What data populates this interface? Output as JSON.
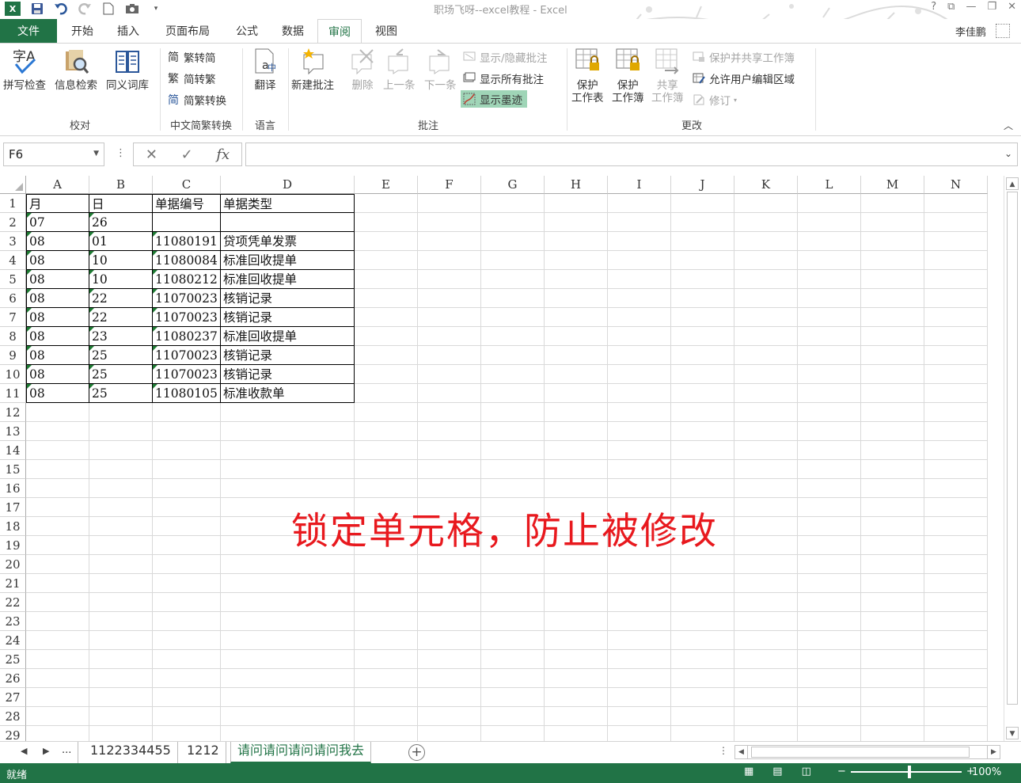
{
  "window": {
    "title": "职场飞呀--excel教程 - Excel",
    "user": "李佳鹏"
  },
  "tabs": [
    {
      "label": "文件"
    },
    {
      "label": "开始"
    },
    {
      "label": "插入"
    },
    {
      "label": "页面布局"
    },
    {
      "label": "公式"
    },
    {
      "label": "数据"
    },
    {
      "label": "审阅"
    },
    {
      "label": "视图"
    }
  ],
  "active_tab": "审阅",
  "ribbon": {
    "proofing": {
      "label": "校对",
      "spell": "拼写检查",
      "research": "信息检索",
      "thesaurus": "同义词库"
    },
    "chinese": {
      "label": "中文简繁转换",
      "to_simplified": "繁转简",
      "to_traditional": "简转繁",
      "convert": "简繁转换",
      "ico_simplified": "简",
      "ico_traditional": "繁",
      "ico_convert": "简"
    },
    "language": {
      "label": "语言",
      "translate": "翻译"
    },
    "comments": {
      "label": "批注",
      "new": "新建批注",
      "delete": "删除",
      "prev": "上一条",
      "next": "下一条",
      "show_hide": "显示/隐藏批注",
      "show_all": "显示所有批注",
      "show_ink": "显示墨迹"
    },
    "changes": {
      "label": "更改",
      "protect_sheet_1": "保护",
      "protect_sheet_2": "工作表",
      "protect_wb_1": "保护",
      "protect_wb_2": "工作簿",
      "share_wb_1": "共享",
      "share_wb_2": "工作簿",
      "protect_share": "保护并共享工作簿",
      "allow_edit": "允许用户编辑区域",
      "track": "修订"
    }
  },
  "formula_bar": {
    "name_box": "F6",
    "formula": "",
    "fx": "fx"
  },
  "columns": [
    "A",
    "B",
    "C",
    "D",
    "E",
    "F",
    "G",
    "H",
    "I",
    "J",
    "K",
    "L",
    "M",
    "N"
  ],
  "rows": [
    "1",
    "2",
    "3",
    "4",
    "5",
    "6",
    "7",
    "8",
    "9",
    "10",
    "11",
    "12",
    "13",
    "14",
    "15",
    "16",
    "17",
    "18",
    "19",
    "20",
    "21",
    "22",
    "23",
    "24",
    "25",
    "26",
    "27",
    "28",
    "29"
  ],
  "table": [
    [
      "月",
      "日",
      "单据编号",
      "单据类型"
    ],
    [
      "07",
      "26",
      "",
      ""
    ],
    [
      "08",
      "01",
      "11080191",
      "贷项凭单发票"
    ],
    [
      "08",
      "10",
      "11080084",
      "标准回收提单"
    ],
    [
      "08",
      "10",
      "11080212",
      "标准回收提单"
    ],
    [
      "08",
      "22",
      "11070023",
      "核销记录"
    ],
    [
      "08",
      "22",
      "11070023",
      "核销记录"
    ],
    [
      "08",
      "23",
      "11080237",
      "标准回收提单"
    ],
    [
      "08",
      "25",
      "11070023",
      "核销记录"
    ],
    [
      "08",
      "25",
      "11070023",
      "核销记录"
    ],
    [
      "08",
      "25",
      "11080105",
      "标准收款单"
    ]
  ],
  "overlay_caption": "锁定单元格，防止被修改",
  "sheets": {
    "ellipsis": "...",
    "tabs": [
      {
        "label": "1122334455"
      },
      {
        "label": "1212"
      },
      {
        "label": "请问请问请问请问我去"
      }
    ]
  },
  "status": {
    "ready": "就绪",
    "zoom": "100%"
  },
  "colors": {
    "brand": "#217346",
    "overlay_text": "#e8191e",
    "ink_highlight": "#9fd5b7"
  }
}
